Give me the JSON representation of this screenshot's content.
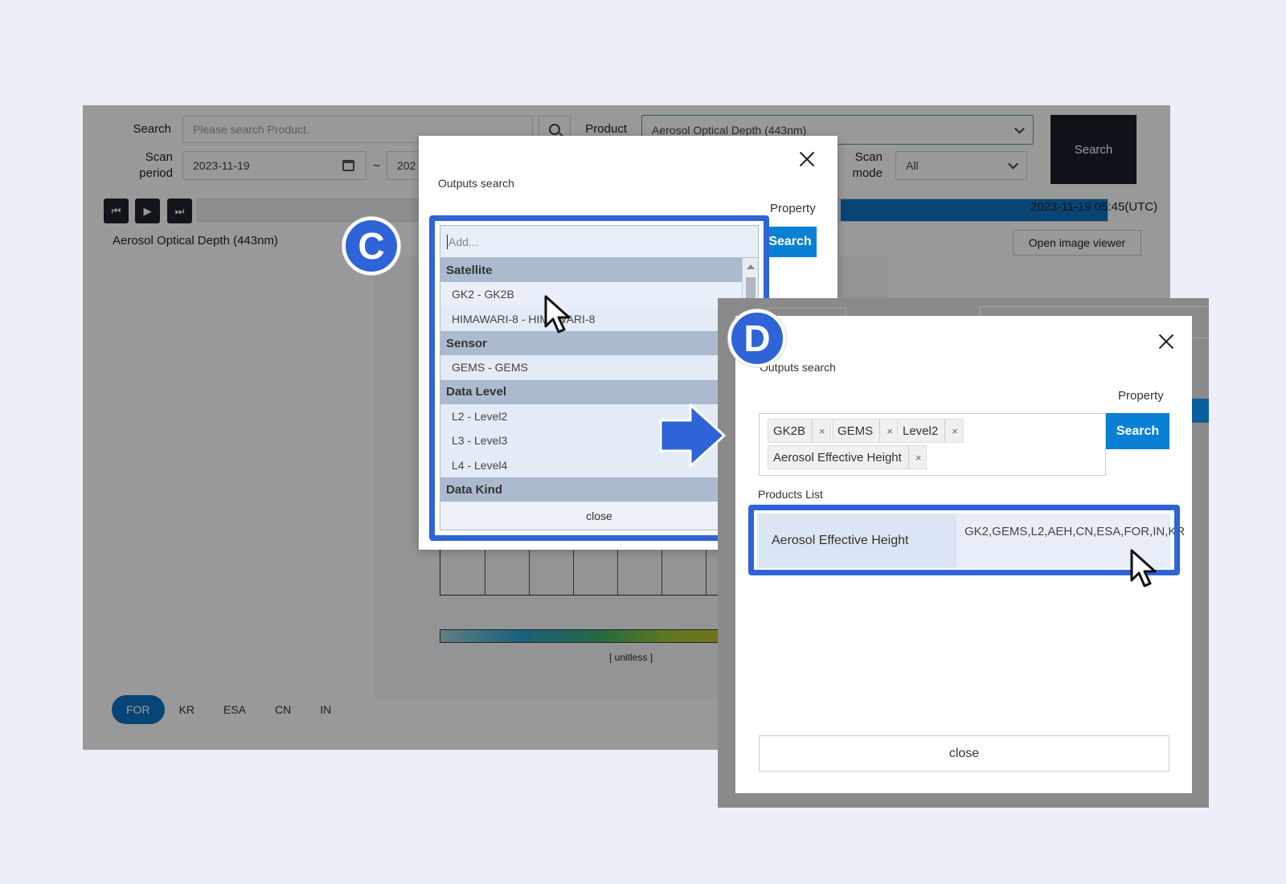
{
  "app": {
    "search_label": "Search",
    "search_placeholder": "Please search Product.",
    "product_label": "Product",
    "product_value": "Aerosol Optical Depth (443nm)",
    "scan_period_label_1": "Scan",
    "scan_period_label_2": "period",
    "scan_start": "2023-11-19",
    "range_sep": "~",
    "scan_end_partial": "202",
    "scan_mode_label_1": "Scan",
    "scan_mode_label_2": "mode",
    "scan_mode_value": "All",
    "search_button": "Search",
    "player": {
      "prev": "⏮",
      "play": "▶",
      "next": "⏭"
    },
    "timestamp": "2023-11-19 05:45(UTC)",
    "product_title": "Aerosol Optical Depth (443nm)",
    "open_viewer": "Open image viewer",
    "colorbar_unit": "[ unitless ]",
    "regions": [
      "FOR",
      "KR",
      "ESA",
      "CN",
      "IN"
    ],
    "active_region": "FOR"
  },
  "dialog_c": {
    "badge": "C",
    "title": "Outputs search",
    "property_label": "Property",
    "search_button": "Search",
    "add_placeholder": "Add...",
    "groups": [
      {
        "label": "Satellite",
        "items": [
          "GK2 - GK2B",
          "HIMAWARI-8 - HIMAWARI-8"
        ]
      },
      {
        "label": "Sensor",
        "items": [
          "GEMS - GEMS"
        ]
      },
      {
        "label": "Data Level",
        "items": [
          "L2 - Level2",
          "L3 - Level3",
          "L4 - Level4"
        ]
      },
      {
        "label": "Data Kind",
        "items": []
      }
    ],
    "close_label": "close"
  },
  "dialog_d": {
    "badge": "D",
    "title": "Outputs search",
    "property_label": "Property",
    "search_button": "Search",
    "tags": [
      "GK2B",
      "GEMS",
      "Level2",
      "Aerosol Effective Height"
    ],
    "tag_remove": "×",
    "products_list_label": "Products List",
    "products": [
      {
        "name": "Aerosol Effective Height",
        "codes": "GK2,GEMS,L2,AEH,CN,ESA,FOR,IN,KR"
      }
    ],
    "close_label": "close"
  },
  "colors": {
    "highlight": "#2e64d8",
    "primary_button": "#0a80d4",
    "dark_button": "#1a1f2b",
    "background": "#eceff7"
  }
}
